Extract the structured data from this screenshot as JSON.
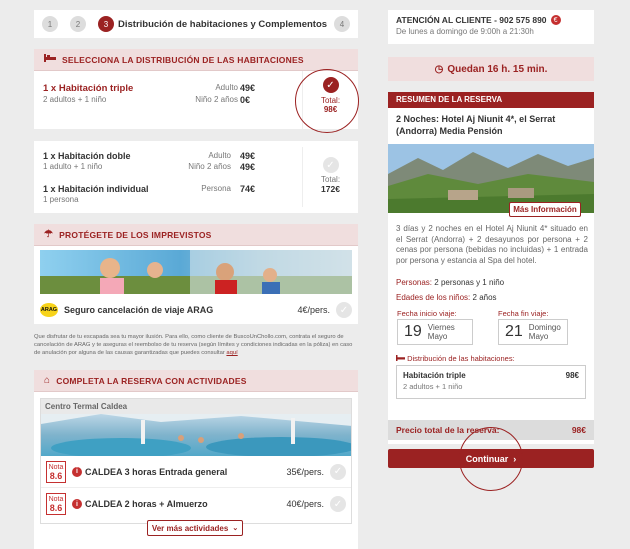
{
  "steps": {
    "s1": "1",
    "s2": "2",
    "s3": "3",
    "s3_label": "Distribución de habitaciones y Complementos",
    "s4": "4"
  },
  "rooms_section": {
    "title": "SELECCIONA LA DISTRIBUCIÓN DE LAS HABITACIONES",
    "option1": {
      "name": "1 x Habitación triple",
      "desc": "2 adultos + 1 niño",
      "label1": "Adulto",
      "label2": "Niño 2 años",
      "price1": "49€",
      "price2": "0€",
      "total_label": "Total:",
      "total": "98€"
    },
    "option2": {
      "room1_name": "1 x Habitación doble",
      "room1_desc": "1 adulto + 1 niño",
      "room1_label1": "Adulto",
      "room1_label2": "Niño 2 años",
      "room1_price1": "49€",
      "room1_price2": "49€",
      "room2_name": "1 x Habitación individual",
      "room2_desc": "1 persona",
      "room2_label": "Persona",
      "room2_price": "74€",
      "total_label": "Total:",
      "total": "172€"
    }
  },
  "insurance": {
    "title": "PROTÉGETE DE LOS IMPREVISTOS",
    "logo": "ARAG",
    "name": "Seguro cancelación de viaje ARAG",
    "price": "4€/pers.",
    "note": "Que disfrutar de tu escapada sea tu mayor ilusión. Para ello, como cliente de BuscoUnChollo.com, contrata el seguro de cancelación de ARAG y te aseguras el reembolso de tu reserva (según límites y condiciones indicadas en la póliza) en caso de anulación por alguna de las causas garantizadas que puedes consultar",
    "note_link": "aquí"
  },
  "activities": {
    "title": "COMPLETA LA RESERVA CON ACTIVIDADES",
    "place": "Centro Termal Caldea",
    "items": [
      {
        "nota_label": "Nota",
        "nota": "8.6",
        "name": "CALDEA 3 horas Entrada general",
        "price": "35€/pers."
      },
      {
        "nota_label": "Nota",
        "nota": "8.6",
        "name": "CALDEA 2 horas + Almuerzo",
        "price": "40€/pers."
      }
    ],
    "more": "Ver más actividades"
  },
  "contact": {
    "title": "ATENCIÓN AL CLIENTE - 902 575 890",
    "hours": "De lunes a domingo de 9:00h a 21:30h"
  },
  "timer": {
    "text": "Quedan 16 h. 15 min."
  },
  "summary": {
    "title": "RESUMEN DE LA RESERVA",
    "hotel": "2 Noches: Hotel Aj Niunit 4*, el Serrat (Andorra) Media Pensión",
    "more_info": "Más Información",
    "description": "3 días y 2 noches en el Hotel Aj Niunit 4* situado en el Serrat (Andorra) + 2 desayunos por persona + 2 cenas por persona (bebidas no incluidas) + 1 entrada por persona y estancia al Spa del hotel.",
    "persons_label": "Personas:",
    "persons": "2 personas y 1 niño",
    "ages_label": "Edades de los niños:",
    "ages": "2 años",
    "start_label": "Fecha inicio viaje:",
    "start_day": "19",
    "start_weekday": "Viernes",
    "start_month": "Mayo",
    "end_label": "Fecha fin viaje:",
    "end_day": "21",
    "end_weekday": "Domingo",
    "end_month": "Mayo",
    "dist_label": "Distribución de las habitaciones:",
    "room_name": "Habitación triple",
    "room_price": "98€",
    "room_desc": "2 adultos + 1 niño",
    "total_label": "Precio total de la reserva:",
    "total": "98€",
    "continue": "Continuar"
  },
  "colors": {
    "accent": "#9b2222",
    "section_bg": "#f0dede",
    "page_bg": "#ececec"
  },
  "icons": [
    "check-icon",
    "bed-icon",
    "umbrella-icon",
    "tag-icon",
    "clock-icon",
    "info-icon",
    "chevron-down-icon",
    "chevron-right-icon",
    "euro-icon"
  ]
}
